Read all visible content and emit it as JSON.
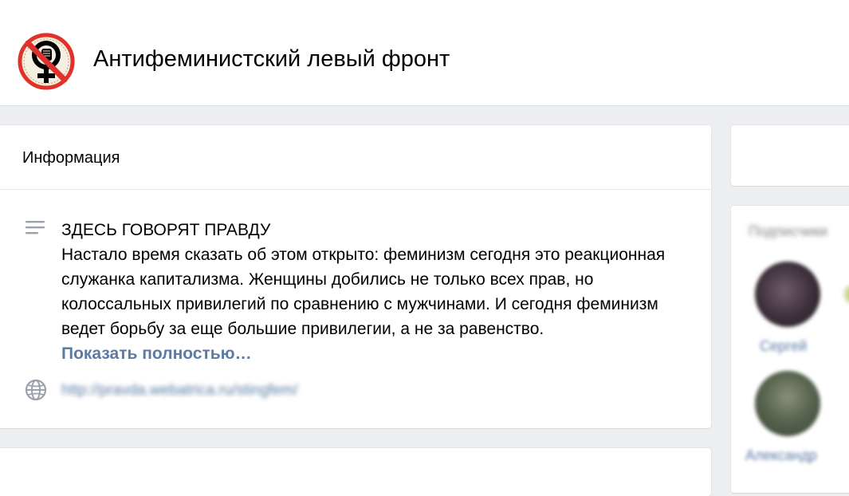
{
  "header": {
    "group_name": "Антифеминистский левый фронт",
    "logo": {
      "icon": "crossed-female-fist-symbol",
      "ring_text": "АНТИФЕМИНИСТСКИЙ ЛЕВЫЙ ФРОНТ",
      "colors": {
        "ring": "#e0322a",
        "symbol": "#000000",
        "background": "#f4efe0"
      }
    }
  },
  "info": {
    "title": "Информация",
    "description_icon": "lines-icon",
    "description_heading": "ЗДЕСЬ ГОВОРЯТ ПРАВДУ",
    "description_text": "Настало время сказать об этом открыто: феминизм сегодня это реакционная служанка капитализма. Женщины добились не только всех прав, но колоссальных привилегий по сравнению с мужчинами. И сегодня феминизм ведет борьбу за еще большие привилегии, а не за равенство.",
    "show_more": "Показать полностью…",
    "website_icon": "globe-icon",
    "website": "http://pravda.webatrica.ru/stingfem/"
  },
  "sidebar": {
    "subscribers_title": "Подписчики",
    "subscribers": [
      {
        "name": "Сергей"
      },
      {
        "name": "Александр"
      }
    ]
  },
  "colors": {
    "link": "#5b7aa4",
    "page_background": "#edeef0",
    "card_background": "#ffffff"
  }
}
